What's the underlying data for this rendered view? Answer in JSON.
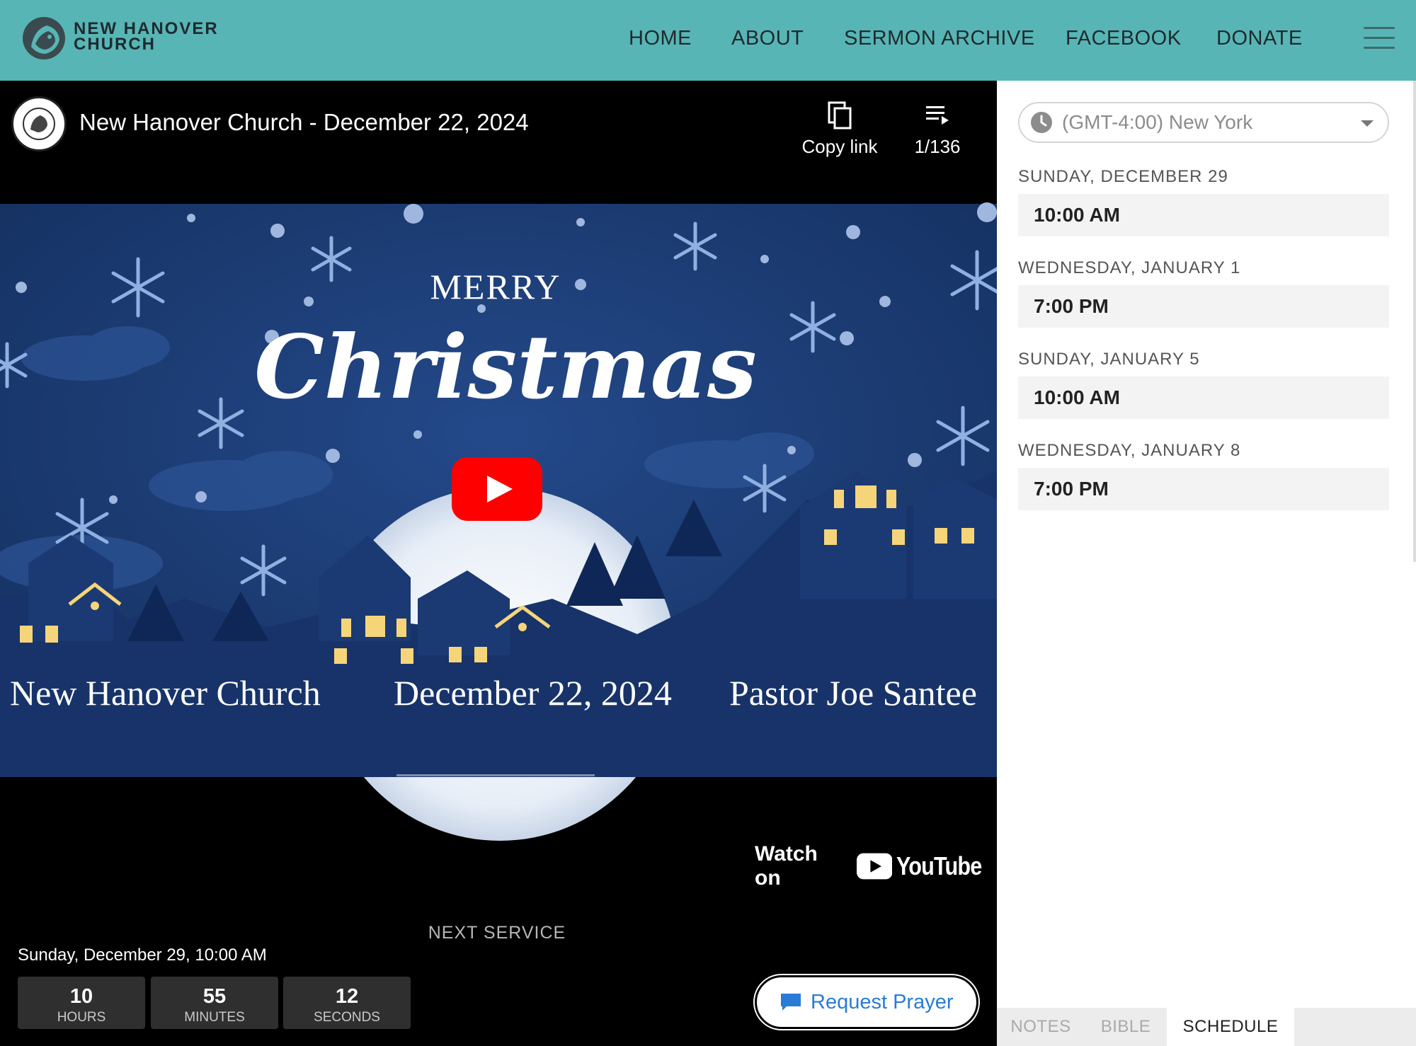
{
  "header": {
    "logo_line1": "NEW HANOVER",
    "logo_line2": "CHURCH",
    "nav": [
      "HOME",
      "ABOUT",
      "SERMON ARCHIVE",
      "FACEBOOK",
      "DONATE"
    ],
    "bg_color": "#58b5b5"
  },
  "video": {
    "title": "New Hanover Church - December 22, 2024",
    "copy_link_label": "Copy link",
    "playlist_count": "1/136",
    "thumbnail": {
      "merry": "MERRY",
      "christmas": "Christmas",
      "church": "New Hanover Church",
      "date": "December 22, 2024",
      "pastor": "Pastor Joe Santee"
    },
    "watch_on": "Watch on",
    "youtube": "YouTube"
  },
  "next_service": {
    "label": "NEXT SERVICE",
    "datetime": "Sunday, December 29, 10:00 AM",
    "countdown": [
      {
        "value": "10",
        "unit": "HOURS"
      },
      {
        "value": "55",
        "unit": "MINUTES"
      },
      {
        "value": "12",
        "unit": "SECONDS"
      }
    ]
  },
  "prayer_button": "Request Prayer",
  "schedule": {
    "timezone": "(GMT-4:00) New York",
    "entries": [
      {
        "day": "SUNDAY, DECEMBER 29",
        "time": "10:00 AM"
      },
      {
        "day": "WEDNESDAY, JANUARY 1",
        "time": "7:00 PM"
      },
      {
        "day": "SUNDAY, JANUARY 5",
        "time": "10:00 AM"
      },
      {
        "day": "WEDNESDAY, JANUARY 8",
        "time": "7:00 PM"
      }
    ]
  },
  "tabs": [
    "NOTES",
    "BIBLE",
    "SCHEDULE"
  ],
  "active_tab": "SCHEDULE",
  "colors": {
    "youtube_red": "#ff0000",
    "prayer_blue": "#2a7bd6",
    "night_blue": "#1d3c74"
  }
}
